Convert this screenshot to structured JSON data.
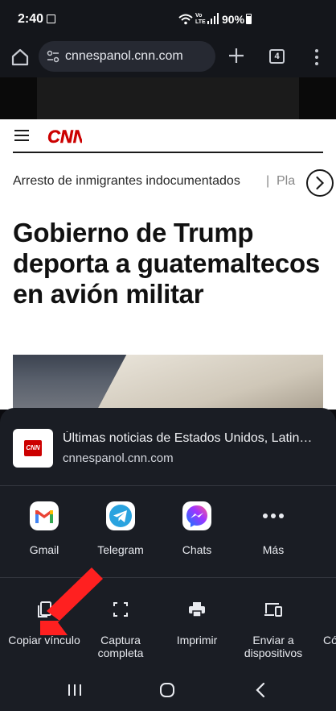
{
  "status_bar": {
    "time": "2:40",
    "network_label": "Vo LTE",
    "battery": "90%"
  },
  "toolbar": {
    "url": "cnnespanol.cnn.com",
    "tab_count": "4"
  },
  "page": {
    "logo_text": "CNN",
    "topics": [
      "Arresto de inmigrantes indocumentados",
      "|",
      "Pla"
    ],
    "headline": "Gobierno de Trump deporta a guatemaltecos en avión militar"
  },
  "share_sheet": {
    "title": "Últimas noticias de Estados Unidos, Latinoamérica y el mundo",
    "url": "cnnespanol.cnn.com",
    "preview_logo_text": "CNN",
    "apps": [
      {
        "label": "Gmail",
        "icon": "gmail-icon"
      },
      {
        "label": "Telegram",
        "icon": "telegram-icon"
      },
      {
        "label": "Chats",
        "icon": "messenger-icon"
      },
      {
        "label": "Más",
        "icon": "more-horizontal-icon"
      }
    ],
    "actions": [
      {
        "label": "Copiar vínculo",
        "icon": "copy-icon"
      },
      {
        "label": "Captura completa",
        "icon": "long-screenshot-icon"
      },
      {
        "label": "Imprimir",
        "icon": "print-icon"
      },
      {
        "label": "Enviar a dispositivos",
        "icon": "devices-icon"
      },
      {
        "label": "Có",
        "icon": "qr-code-icon"
      }
    ]
  },
  "colors": {
    "sheet_background": "#1a1d24",
    "cnn_red": "#cc0000",
    "arrow_red": "#ff2020"
  }
}
